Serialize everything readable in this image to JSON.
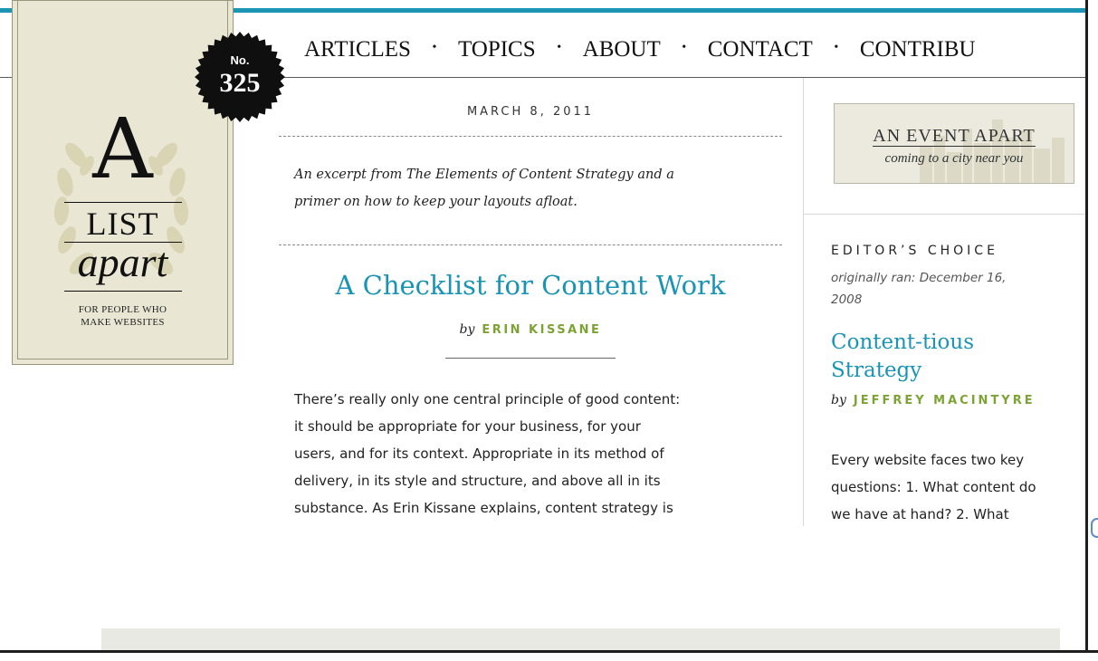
{
  "issue": {
    "no_label": "No.",
    "number": "325"
  },
  "logo": {
    "letter": "A",
    "list": "LIST",
    "apart": "apart",
    "tagline_line1": "FOR PEOPLE WHO",
    "tagline_line2": "MAKE WEBSITES"
  },
  "nav": {
    "items": [
      "ARTICLES",
      "TOPICS",
      "ABOUT",
      "CONTACT",
      "CONTRIBU"
    ],
    "separator": "•"
  },
  "article": {
    "date": "MARCH 8, 2011",
    "excerpt_line1": "An excerpt from The Elements of Content Strategy and a",
    "excerpt_line2": "primer on how to keep your layouts afloat.",
    "title": "A Checklist for Content Work",
    "by": "by",
    "author": "ERIN KISSANE",
    "body_lines": [
      "There’s really only one central principle of good content:",
      "it should be appropriate for your business, for your",
      "users, and for its context. Appropriate in its method of",
      "delivery, in its style and structure, and above all in its",
      "substance. As Erin Kissane explains, content strategy is"
    ]
  },
  "sidebar": {
    "ad": {
      "title": "AN EVENT APART",
      "subtitle": "coming to a city near you"
    },
    "editors_choice": {
      "heading": "EDITOR’S CHOICE",
      "ran_line1": "originally ran: December 16,",
      "ran_line2": "2008",
      "title_line1": "Content-tious",
      "title_line2": "Strategy",
      "by": "by",
      "author": "JEFFREY MACINTYRE",
      "body_lines": [
        "Every website faces two key",
        "questions: 1. What content do",
        "we have at hand? 2. What"
      ]
    }
  },
  "colors": {
    "accent_blue": "#1a94b5",
    "author_green": "#7ca334",
    "logo_bg": "#e9e7d4"
  }
}
